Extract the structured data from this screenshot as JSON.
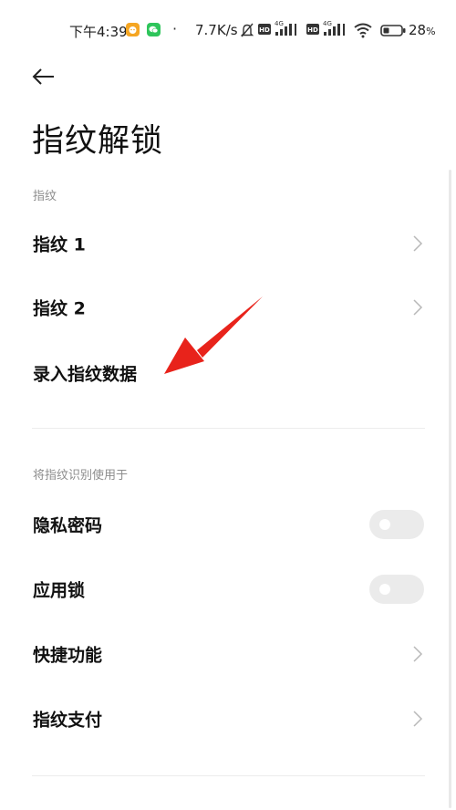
{
  "status_bar": {
    "time": "下午4:39",
    "separator": "·",
    "network_speed": "7.7K/s",
    "network_type_1": "4G",
    "network_type_2": "4G",
    "hd_badge": "HD",
    "battery_percent": "28",
    "battery_unit": "%",
    "icons": [
      "notification-app-icon",
      "wechat-icon",
      "mute-icon",
      "hd-icon",
      "signal-icon",
      "hd-icon",
      "signal-icon",
      "wifi-icon",
      "battery-icon"
    ],
    "colors": {
      "app_badge": "#f5a623",
      "wechat": "#2ec55b"
    }
  },
  "header": {
    "back_icon": "back-arrow-icon",
    "title": "指纹解锁"
  },
  "sections": {
    "fingerprints": {
      "label": "指纹",
      "items": [
        {
          "label": "指纹 1",
          "control": "chevron"
        },
        {
          "label": "指纹 2",
          "control": "chevron"
        },
        {
          "label": "录入指纹数据",
          "control": "none"
        }
      ]
    },
    "usage": {
      "label": "将指纹识别使用于",
      "items": [
        {
          "label": "隐私密码",
          "control": "toggle",
          "enabled": false
        },
        {
          "label": "应用锁",
          "control": "toggle",
          "enabled": false
        },
        {
          "label": "快捷功能",
          "control": "chevron"
        },
        {
          "label": "指纹支付",
          "control": "chevron"
        }
      ]
    }
  },
  "annotation": {
    "type": "red-arrow",
    "color": "#e8231b",
    "points_to": "录入指纹数据"
  }
}
